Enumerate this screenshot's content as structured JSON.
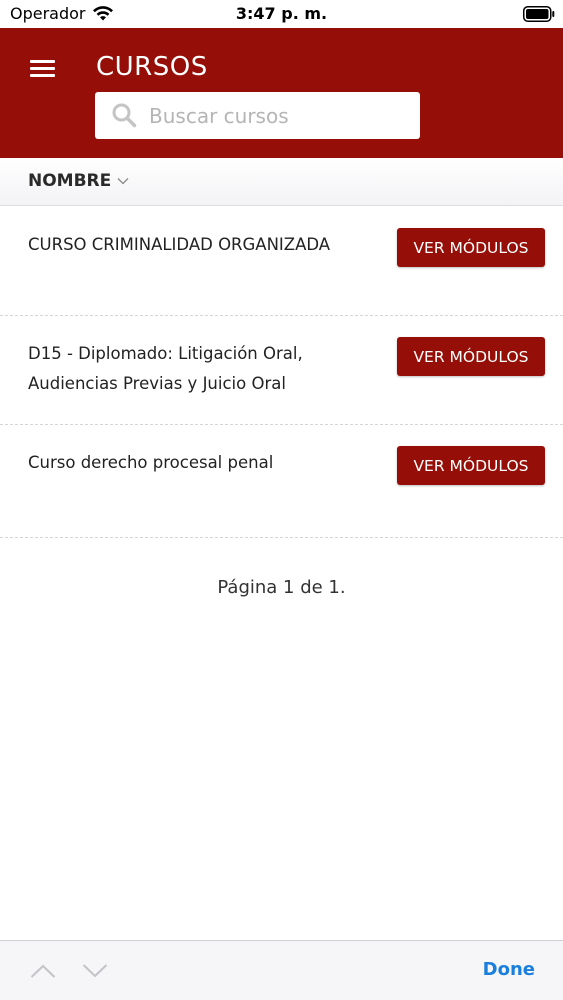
{
  "status_bar": {
    "carrier": "Operador",
    "time": "3:47 p. m."
  },
  "header": {
    "title": "CURSOS",
    "search_placeholder": "Buscar cursos",
    "search_value": "",
    "background_color": "#950e07"
  },
  "sort": {
    "label": "NOMBRE"
  },
  "courses": [
    {
      "name": "CURSO CRIMINALIDAD ORGANIZADA",
      "button_label": "VER MÓDULOS"
    },
    {
      "name": "D15 - Diplomado: Litigación Oral, Audiencias Previas y Juicio Oral",
      "button_label": "VER MÓDULOS"
    },
    {
      "name": "Curso derecho procesal penal",
      "button_label": "VER MÓDULOS"
    }
  ],
  "pagination": {
    "text": "Página 1 de 1."
  },
  "accessory_bar": {
    "done_label": "Done",
    "accent_color": "#1a7fdc"
  },
  "icons": {
    "menu": "menu-icon",
    "search": "search-icon",
    "sort": "chevron-down-icon",
    "previous": "chevron-up-icon",
    "next": "chevron-down-icon"
  }
}
